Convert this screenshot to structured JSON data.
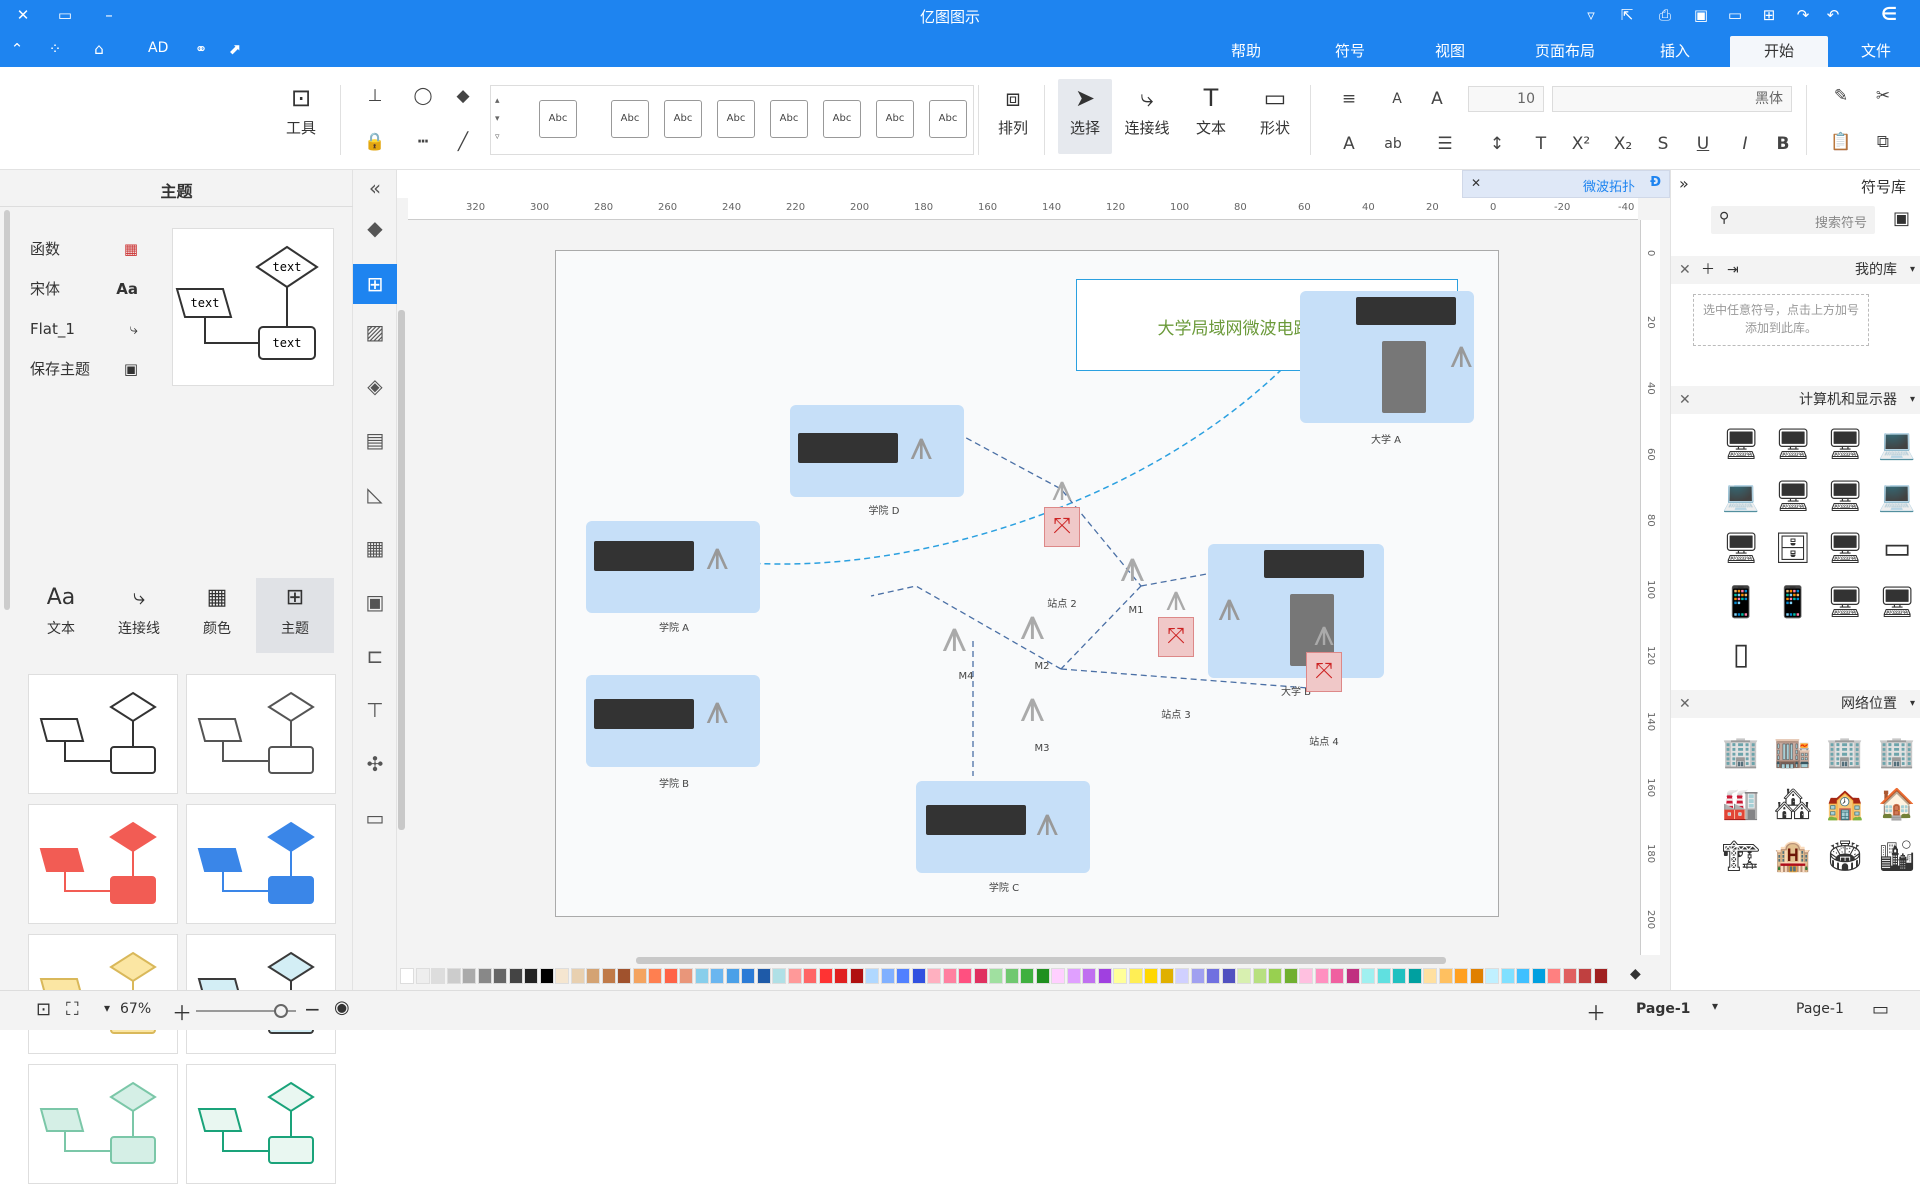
{
  "app": {
    "title": "亿图图示",
    "colors": {
      "accent": "#1e84f0"
    }
  },
  "quickbar": {
    "icons": [
      "logo-icon",
      "undo-icon",
      "redo-icon",
      "new-icon",
      "open-icon",
      "save-icon",
      "print-icon",
      "export-icon",
      "more-icon",
      "close-icon",
      "minimize-icon"
    ]
  },
  "toolbar2": {
    "icons": [
      "nav-icon",
      "share-icon",
      "theme-icon",
      "apps-icon",
      "collapse-icon"
    ],
    "ad_label": "AD"
  },
  "tabs": [
    {
      "label": "文件"
    },
    {
      "label": "开始"
    },
    {
      "label": "插入"
    },
    {
      "label": "页面布局"
    },
    {
      "label": "视图"
    },
    {
      "label": "符号"
    },
    {
      "label": "帮助"
    }
  ],
  "ribbon": {
    "font_name": "黑体",
    "font_size": "10",
    "big": [
      {
        "label": "形状"
      },
      {
        "label": "文本"
      },
      {
        "label": "连接线"
      },
      {
        "label": "选择"
      },
      {
        "label": "排列"
      },
      {
        "label": "工具"
      }
    ],
    "style_sample": "Abc"
  },
  "left_panel": {
    "title": "主题",
    "options": [
      {
        "label": "函数"
      },
      {
        "label": "宋体"
      },
      {
        "label": "Flat_1"
      },
      {
        "label": "保存主题"
      }
    ],
    "tabs": [
      {
        "label": "主题"
      },
      {
        "label": "颜色"
      },
      {
        "label": "连接线"
      },
      {
        "label": "文本"
      }
    ],
    "preview_text": "text"
  },
  "document": {
    "tab": "微波拓扑"
  },
  "ruler": {
    "h": [
      "-40",
      "-20",
      "0",
      "20",
      "40",
      "60",
      "80",
      "100",
      "120",
      "140",
      "160",
      "180",
      "200",
      "220",
      "240",
      "260",
      "280",
      "300",
      "320"
    ],
    "v": [
      "0",
      "20",
      "40",
      "60",
      "80",
      "100",
      "120",
      "140",
      "160",
      "180",
      "200"
    ]
  },
  "diagram": {
    "title": "大学局域网微波电路拓扑结构",
    "nodes": [
      {
        "label": "大学 A"
      },
      {
        "label": "学院 D"
      },
      {
        "label": "大学 B"
      },
      {
        "label": "学院 A"
      },
      {
        "label": "学院 B"
      },
      {
        "label": "学院 C"
      }
    ],
    "sites": [
      {
        "label": "站点 2"
      },
      {
        "label": "站点 3"
      },
      {
        "label": "站点 4"
      }
    ],
    "towers": [
      {
        "label": "M1"
      },
      {
        "label": "M2"
      },
      {
        "label": "M3"
      },
      {
        "label": "M4"
      }
    ]
  },
  "right_panel": {
    "title": "符号库",
    "search_placeholder": "搜索符号",
    "my_lib": "我的库",
    "my_lib_hint": "选中任意符号，点击上方加号添加到此库。",
    "lib1": "计算机和显示器",
    "lib2": "网络位置"
  },
  "status": {
    "page_tab": "Page-1",
    "page_current": "Page-1",
    "zoom": "67%"
  }
}
